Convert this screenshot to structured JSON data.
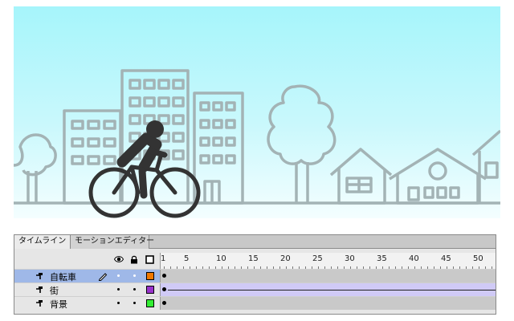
{
  "timeline": {
    "tabs": [
      {
        "label": "タイムライン",
        "active": true
      },
      {
        "label": "モーションエディター",
        "active": false
      }
    ],
    "ruler": {
      "frames": [
        "1",
        "5",
        "10",
        "15",
        "20",
        "25",
        "30",
        "35",
        "40",
        "45",
        "50"
      ]
    },
    "header_icons": [
      "eye-icon",
      "lock-icon",
      "outline-icon"
    ],
    "layers": [
      {
        "name": "自転車",
        "selected": true,
        "color": "#f07800",
        "has_pencil": true,
        "frame_type": "keyframe"
      },
      {
        "name": "街",
        "selected": false,
        "color": "#9933cc",
        "has_pencil": false,
        "frame_type": "motion-tween"
      },
      {
        "name": "背景",
        "selected": false,
        "color": "#33ee33",
        "has_pencil": false,
        "frame_type": "keyframe"
      }
    ]
  },
  "stage": {
    "sky_color_top": "#a6f5fb",
    "sky_color_bottom": "#f4feff",
    "outline_color": "#a3b3b5",
    "cyclist_color": "#333333",
    "icons": [
      "cyclist-icon",
      "building-icon",
      "tree-icon",
      "house-icon"
    ]
  }
}
